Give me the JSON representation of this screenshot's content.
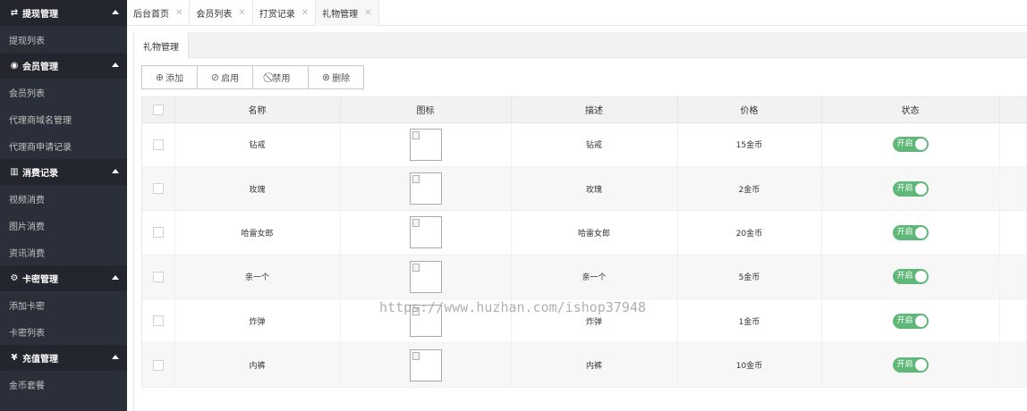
{
  "sidebar": {
    "groups": [
      {
        "title": "提现管理",
        "icon": "exchange-icon",
        "glyph": "⇄",
        "items": [
          "提现列表"
        ]
      },
      {
        "title": "会员管理",
        "icon": "user-icon",
        "glyph": "◉",
        "items": [
          "会员列表",
          "代理商域名管理",
          "代理商申请记录"
        ]
      },
      {
        "title": "消费记录",
        "icon": "bar-chart-icon",
        "glyph": "▥",
        "items": [
          "视频消费",
          "图片消费",
          "资讯消费"
        ]
      },
      {
        "title": "卡密管理",
        "icon": "cog-icon",
        "glyph": "⚙",
        "items": [
          "添加卡密",
          "卡密列表"
        ]
      },
      {
        "title": "充值管理",
        "icon": "yen-icon",
        "glyph": "¥",
        "items": [
          "金币套餐"
        ]
      }
    ]
  },
  "tabs": [
    {
      "label": "后台首页",
      "close": "✕",
      "active": false
    },
    {
      "label": "会员列表",
      "close": "✕",
      "active": false
    },
    {
      "label": "打赏记录",
      "close": "✕",
      "active": false
    },
    {
      "label": "礼物管理",
      "close": "✕",
      "active": true
    }
  ],
  "page": {
    "tab_label": "礼物管理"
  },
  "toolbar": {
    "buttons": [
      {
        "name": "add",
        "label": "添加",
        "glyph": "⊕",
        "icon": "plus-circle-icon"
      },
      {
        "name": "enable",
        "label": "启用",
        "glyph": "⊘",
        "icon": "check-circle-icon"
      },
      {
        "name": "disable",
        "label": "禁用",
        "glyph": "⃠",
        "icon": "ban-icon"
      },
      {
        "name": "delete",
        "label": "删除",
        "glyph": "⊗",
        "icon": "x-circle-icon"
      }
    ]
  },
  "table": {
    "columns": [
      "名称",
      "图标",
      "描述",
      "价格",
      "状态"
    ],
    "rows": [
      {
        "name": "钻戒",
        "desc": "钻戒",
        "price": "15金币",
        "status": "开启"
      },
      {
        "name": "玫瑰",
        "desc": "玫瑰",
        "price": "2金币",
        "status": "开启"
      },
      {
        "name": "哈雷女郎",
        "desc": "哈雷女郎",
        "price": "20金币",
        "status": "开启"
      },
      {
        "name": "亲一个",
        "desc": "亲一个",
        "price": "5金币",
        "status": "开启"
      },
      {
        "name": "炸弹",
        "desc": "炸弹",
        "price": "1金币",
        "status": "开启"
      },
      {
        "name": "内裤",
        "desc": "内裤",
        "price": "10金币",
        "status": "开启"
      }
    ]
  },
  "colors": {
    "sidebar_bg": "#2b2f3a",
    "sidebar_head_bg": "#23262e",
    "switch_on": "#5fb878"
  },
  "watermark": "https://www.huzhan.com/ishop37948"
}
